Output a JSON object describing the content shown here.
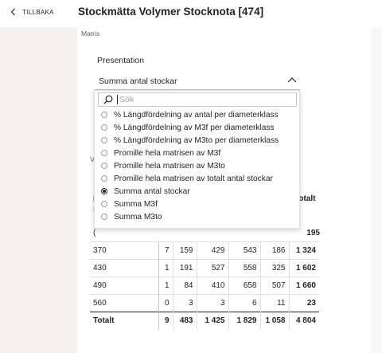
{
  "header": {
    "back_label": "TILLBAKA",
    "title": "Stockmätta Volymer Stocknota [474]"
  },
  "section_label": "Matris",
  "presentation": {
    "label": "Presentation",
    "selected": "Summa antal stockar",
    "search_placeholder": "Sök",
    "options": [
      {
        "label": "% Längdfördelning av antal per diameterklass",
        "selected": false
      },
      {
        "label": "% Längdfördelning av M3f per diameterklass",
        "selected": false
      },
      {
        "label": "% Längdfördelning av M3to per diameterklass",
        "selected": false
      },
      {
        "label": "Promille hela matrisen av M3f",
        "selected": false
      },
      {
        "label": "Promille hela matrisen av M3to",
        "selected": false
      },
      {
        "label": "Promille hela matrisen av totalt antal stockar",
        "selected": false
      },
      {
        "label": "Summa antal stockar",
        "selected": true
      },
      {
        "label": "Summa M3f",
        "selected": false
      },
      {
        "label": "Summa M3to",
        "selected": false
      }
    ]
  },
  "matrix": {
    "peek": {
      "v": "Vä",
      "d": "D",
      "l": "L",
      "c": "(",
      "totalt_header": "Totalt",
      "first_total": "195"
    },
    "rows": [
      {
        "label": "370",
        "c1": "7",
        "c2": "159",
        "c3": "429",
        "c4": "543",
        "c5": "186",
        "total": "1 324"
      },
      {
        "label": "430",
        "c1": "1",
        "c2": "191",
        "c3": "527",
        "c4": "558",
        "c5": "325",
        "total": "1 602"
      },
      {
        "label": "490",
        "c1": "1",
        "c2": "84",
        "c3": "410",
        "c4": "658",
        "c5": "507",
        "total": "1 660"
      },
      {
        "label": "560",
        "c1": "0",
        "c2": "3",
        "c3": "3",
        "c4": "6",
        "c5": "11",
        "total": "23"
      }
    ],
    "total_row": {
      "label": "Totalt",
      "c1": "9",
      "c2": "483",
      "c3": "1 425",
      "c4": "1 829",
      "c5": "1 058",
      "total": "4 804"
    }
  }
}
